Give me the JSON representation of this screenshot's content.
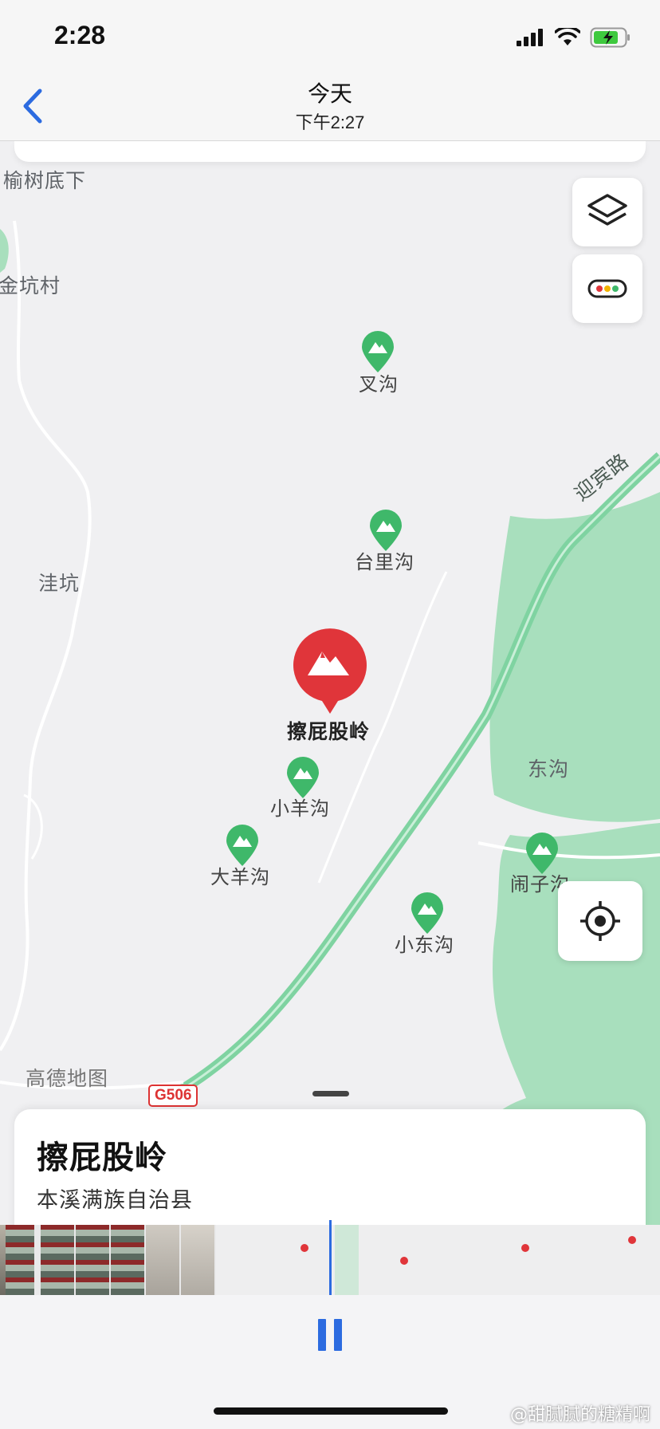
{
  "status_bar": {
    "time": "2:28"
  },
  "header": {
    "title": "今天",
    "subtitle": "下午2:27"
  },
  "map": {
    "labels": {
      "yushu": "榆树底下",
      "jinkeng": "金坑村",
      "wakeng": "洼坑",
      "yingbin_road": "迎宾路",
      "donggou": "东沟",
      "provider": "高德地图",
      "road_shield": "G506"
    },
    "pois": {
      "chagou": "叉沟",
      "tailigou": "台里沟",
      "xiaoyanggou": "小羊沟",
      "dayanggou": "大羊沟",
      "naozigou": "闹子沟",
      "xiaodonggou": "小东沟"
    },
    "selected": "擦屁股岭"
  },
  "sheet": {
    "name": "擦屁股岭",
    "region": "本溪满族自治县"
  },
  "watermark": "@甜腻腻的糖精啊",
  "colors": {
    "pin_red": "#e0353a",
    "poi_green": "#3fb86a",
    "water_green": "#a8dfbd",
    "road_green": "#7fd3a1",
    "accent_blue": "#2c6be0"
  }
}
